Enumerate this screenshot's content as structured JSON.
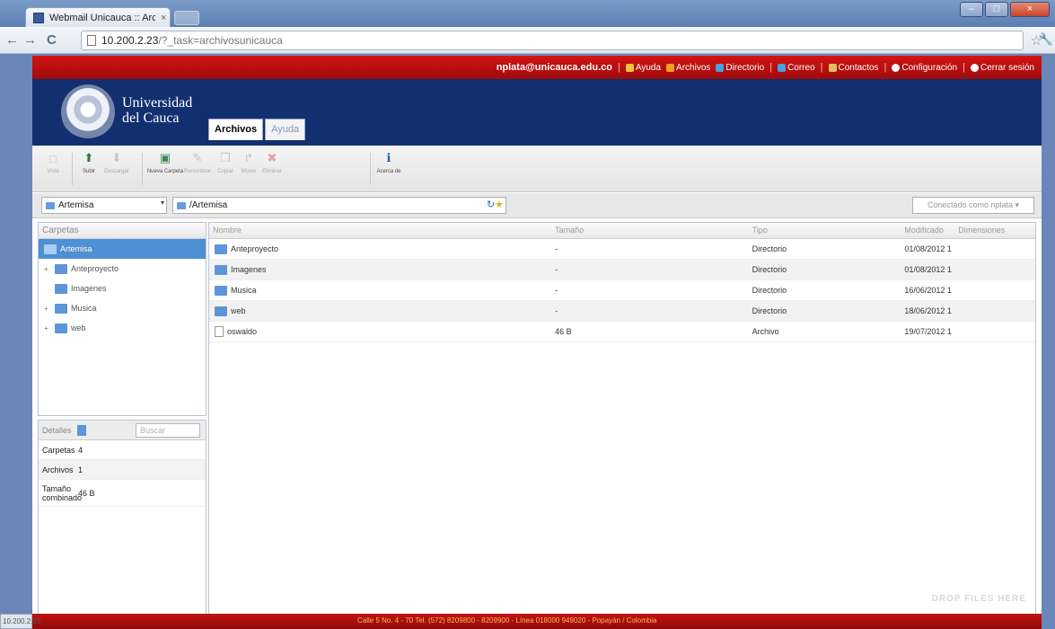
{
  "browser": {
    "tab_title": "Webmail Unicauca :: Archi",
    "tab_close": "×",
    "url_host": "10.200.2.23",
    "url_path": "/?_task=archivosunicauca",
    "win_min": "–",
    "win_max": "□",
    "win_close": "×",
    "back": "←",
    "forward": "→",
    "reload": "C",
    "star": "☆",
    "wrench": "🔧"
  },
  "topbar": {
    "email": "nplata@unicauca.edu.co",
    "links": [
      "Ayuda",
      "Archivos",
      "Directorio",
      "Correo",
      "Contactos",
      "Configuración",
      "Cerrar sesión"
    ],
    "colors": [
      "#f0c040",
      "#f0a020",
      "#4aa0e0",
      "#4aa0e0",
      "#e0c060",
      "#ffffff",
      "#ffffff"
    ]
  },
  "brand": {
    "line1": "Universidad",
    "line2": "del Cauca"
  },
  "main_tabs": [
    "Archivos",
    "Ayuda"
  ],
  "actions": [
    {
      "label": "Vista",
      "icon": "□",
      "disabled": true
    },
    {
      "label": "Subir",
      "icon": "⬆",
      "disabled": false
    },
    {
      "label": "Descargar",
      "icon": "⬇",
      "disabled": true
    },
    {
      "label": "Nueva Carpeta",
      "icon": "▣",
      "disabled": false
    },
    {
      "label": "Renombrar",
      "icon": "✎",
      "disabled": true
    },
    {
      "label": "Copiar",
      "icon": "❐",
      "disabled": true
    },
    {
      "label": "Mover",
      "icon": "↱",
      "disabled": true
    },
    {
      "label": "Eliminar",
      "icon": "✖",
      "disabled": true
    },
    {
      "label": "Acerca de",
      "icon": "ℹ",
      "disabled": false
    }
  ],
  "path": {
    "source": "Artemisa",
    "path_value": "/Artemisa",
    "connected": "Conectado como nplata ▾",
    "dropdown": "▾"
  },
  "folders": {
    "header": "Carpetas",
    "items": [
      {
        "label": "Artemisa",
        "selected": true,
        "twisty": ""
      },
      {
        "label": "Anteproyecto",
        "selected": false,
        "twisty": "+"
      },
      {
        "label": "Imagenes",
        "selected": false,
        "twisty": ""
      },
      {
        "label": "Musica",
        "selected": false,
        "twisty": "+"
      },
      {
        "label": "web",
        "selected": false,
        "twisty": "+"
      }
    ]
  },
  "details": {
    "tab": "Detalles",
    "search_placeholder": "Buscar",
    "rows": [
      {
        "k": "Carpetas",
        "v": "4"
      },
      {
        "k": "Archivos",
        "v": "1"
      },
      {
        "k": "Tamaño combinado",
        "v": "46 B"
      }
    ]
  },
  "files": {
    "columns": [
      "Nombre",
      "Tamaño",
      "Tipo",
      "Modificado",
      "Dimensiones"
    ],
    "rows": [
      {
        "name": "Anteproyecto",
        "size": "-",
        "type": "Directorio",
        "modified": "01/08/2012 1",
        "dims": "",
        "kind": "dir"
      },
      {
        "name": "Imagenes",
        "size": "-",
        "type": "Directorio",
        "modified": "01/08/2012 1",
        "dims": "",
        "kind": "dir"
      },
      {
        "name": "Musica",
        "size": "-",
        "type": "Directorio",
        "modified": "16/06/2012 1",
        "dims": "",
        "kind": "dir"
      },
      {
        "name": "web",
        "size": "-",
        "type": "Directorio",
        "modified": "18/06/2012 1",
        "dims": "",
        "kind": "dir"
      },
      {
        "name": "oswaldo",
        "size": "46 B",
        "type": "Archivo",
        "modified": "19/07/2012 1",
        "dims": "",
        "kind": "file"
      }
    ],
    "drop_hint": "DROP FILES HERE"
  },
  "footer": {
    "text": "Calle 5 No. 4 - 70 Tel. (572) 8209800 - 8209900 - Línea 018000 949020 - Popayán / Colombia",
    "status": "10.200.2.23"
  }
}
